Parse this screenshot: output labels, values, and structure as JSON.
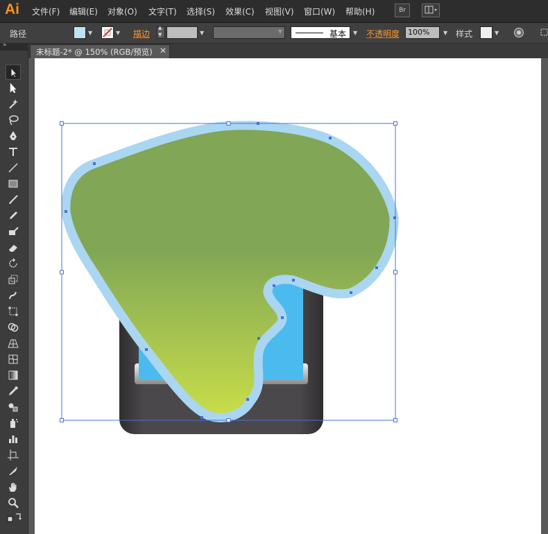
{
  "app": {
    "logo": "Ai",
    "logo_color": "#f7931e",
    "menu": [
      "文件(F)",
      "编辑(E)",
      "对象(O)",
      "文字(T)",
      "选择(S)",
      "效果(C)",
      "视图(V)",
      "窗口(W)",
      "帮助(H)"
    ],
    "bridge_label": "Br"
  },
  "control_bar": {
    "selection_label": "路径",
    "fill_color": "#bfe3f5",
    "stroke_label": "描边",
    "stroke_style_label": "基本",
    "opacity_label": "不透明度",
    "opacity_value": "100%",
    "style_label": "样式"
  },
  "document_tab": {
    "title": "未标题-2* @ 150% (RGB/预览)",
    "close_glyph": "✕"
  },
  "tools": [
    "selection-tool",
    "direct-selection-tool",
    "magic-wand-tool",
    "lasso-tool",
    "pen-tool",
    "type-tool",
    "line-segment-tool",
    "rectangle-tool",
    "paintbrush-tool",
    "pencil-tool",
    "blob-brush-tool",
    "eraser-tool",
    "rotate-tool",
    "scale-tool",
    "warp-tool",
    "free-transform-tool",
    "shape-builder-tool",
    "perspective-grid-tool",
    "mesh-tool",
    "gradient-tool",
    "eyedropper-tool",
    "blend-tool",
    "symbol-sprayer-tool",
    "column-graph-tool",
    "artboard-tool",
    "slice-tool",
    "hand-tool",
    "zoom-tool"
  ],
  "artwork": {
    "device_body_color": "#3e3c3e",
    "screen_color": "#4bbbef",
    "blob_top_color": "#80a656",
    "blob_bottom_color": "#c9de4a",
    "blob_outline_color": "#aad6f2",
    "selection_color": "#4a6fd8"
  }
}
